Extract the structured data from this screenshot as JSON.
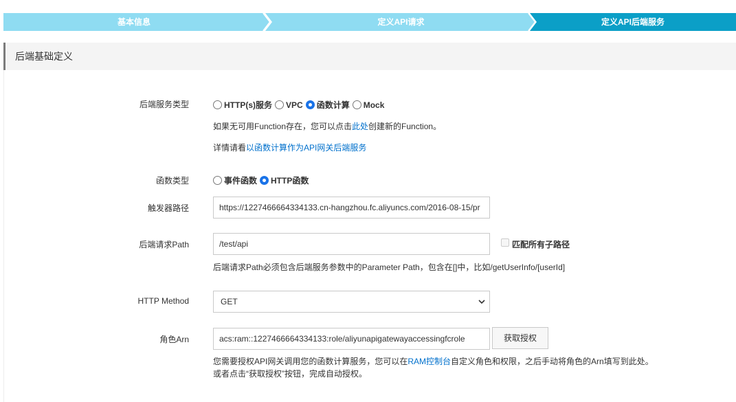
{
  "steps": [
    {
      "label": "基本信息",
      "state": "done"
    },
    {
      "label": "定义API请求",
      "state": "done"
    },
    {
      "label": "定义API后端服务",
      "state": "active"
    }
  ],
  "colors": {
    "step_done": "#8fdcf2",
    "step_active": "#0b9fc7",
    "link": "#0070cc"
  },
  "section": {
    "title": "后端基础定义"
  },
  "backend_type": {
    "label": "后端服务类型",
    "options": [
      "HTTP(s)服务",
      "VPC",
      "函数计算",
      "Mock"
    ],
    "selected": "函数计算",
    "hint_prefix": "如果无可用Function存在，您可以点击",
    "hint_link": "此处",
    "hint_suffix": "创建新的Function。",
    "detail_prefix": "详情请看",
    "detail_link": "以函数计算作为API网关后端服务"
  },
  "function_type": {
    "label": "函数类型",
    "options": [
      "事件函数",
      "HTTP函数"
    ],
    "selected": "HTTP函数"
  },
  "trigger_path": {
    "label": "触发器路径",
    "value": "https://1227466664334133.cn-hangzhou.fc.aliyuncs.com/2016-08-15/pr"
  },
  "backend_path": {
    "label": "后端请求Path",
    "value": "/test/api",
    "match_all_label": "匹配所有子路径",
    "hint": "后端请求Path必须包含后端服务参数中的Parameter Path，包含在[]中，比如/getUserInfo/[userId]"
  },
  "http_method": {
    "label": "HTTP Method",
    "value": "GET"
  },
  "role_arn": {
    "label": "角色Arn",
    "value": "acs:ram::1227466664334133:role/aliyunapigatewayaccessingfcrole",
    "button": "获取授权",
    "hint1_prefix": "您需要授权API网关调用您的函数计算服务，您可以在",
    "hint1_link": "RAM控制台",
    "hint1_suffix": "自定义角色和权限，之后手动将角色的Arn填写到此处。",
    "hint2": "或者点击“获取授权”按钮，完成自动授权。"
  }
}
